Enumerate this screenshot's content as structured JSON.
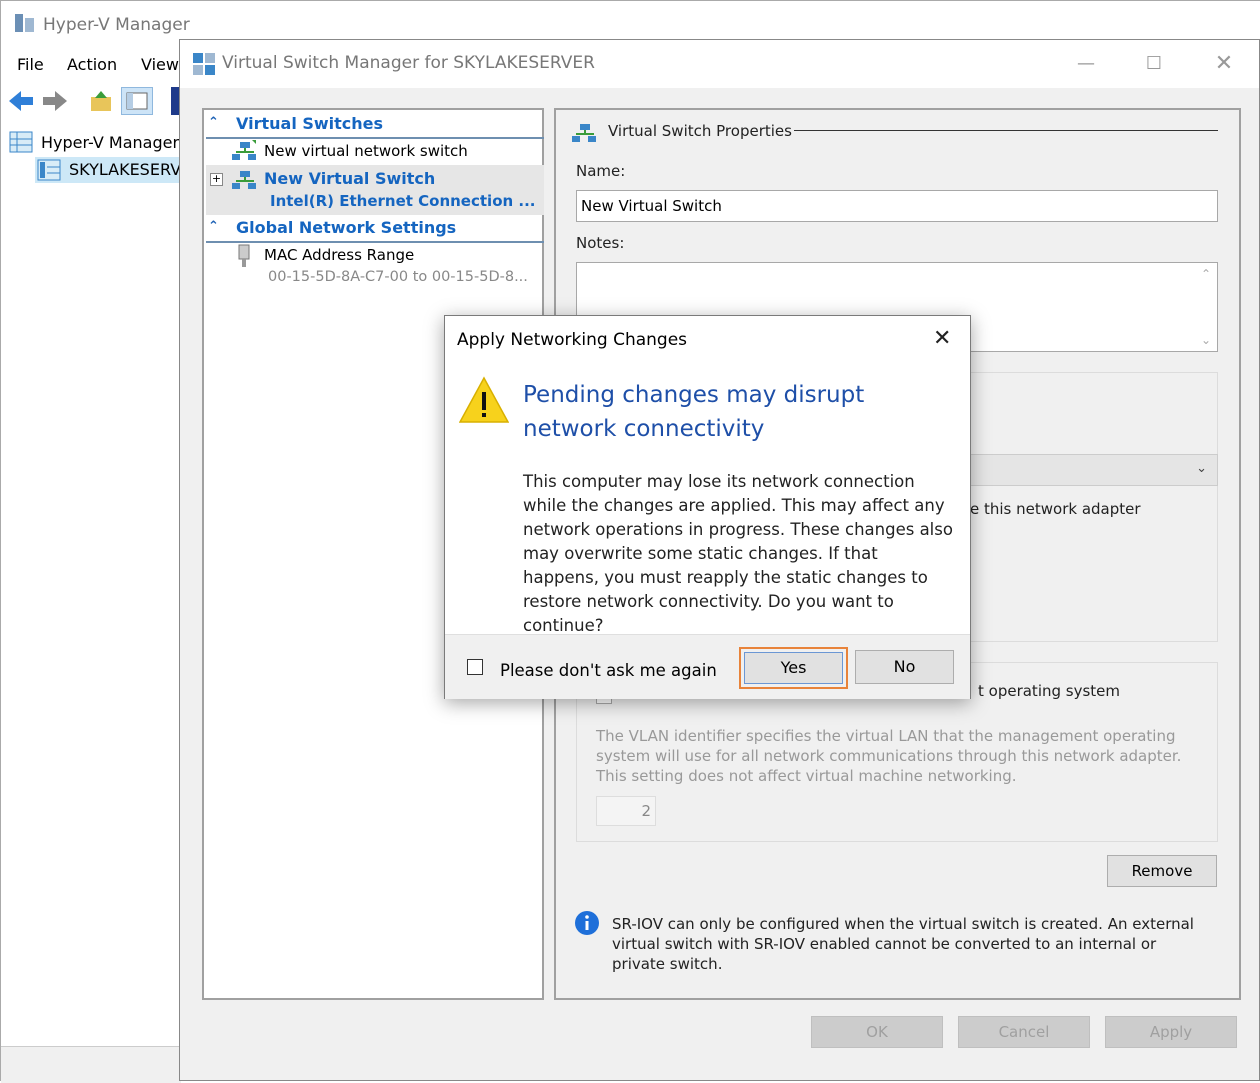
{
  "hyperv": {
    "title": "Hyper-V Manager",
    "menu": [
      "File",
      "Action",
      "View"
    ],
    "tree": {
      "root": "Hyper-V Manager",
      "server": "SKYLAKESERVE"
    }
  },
  "vsm": {
    "title": "Virtual Switch Manager for SKYLAKESERVER",
    "left": {
      "virtual_switches": "Virtual Switches",
      "new_switch_item": "New virtual network switch",
      "switch_name": "New Virtual Switch",
      "switch_adapter": "Intel(R) Ethernet Connection ...",
      "global_settings": "Global Network Settings",
      "mac_label": "MAC Address Range",
      "mac_value": "00-15-5D-8A-C7-00 to 00-15-5D-8..."
    },
    "right": {
      "properties_header": "Virtual Switch Properties",
      "name_label": "Name:",
      "name_value": "New Virtual Switch",
      "notes_label": "Notes:",
      "adapter_text": "e this network adapter",
      "os_text": "t operating system",
      "vlan_description": "The VLAN identifier specifies the virtual LAN that the management operating system will use for all network communications through this network adapter. This setting does not affect virtual machine networking.",
      "vlan_id": "2",
      "remove_label": "Remove",
      "sriov_info": "SR-IOV can only be configured when the virtual switch is created. An external virtual switch with SR-IOV enabled cannot be converted to an internal or private switch."
    },
    "buttons": {
      "ok": "OK",
      "cancel": "Cancel",
      "apply": "Apply"
    }
  },
  "dialog": {
    "title": "Apply Networking Changes",
    "heading": "Pending changes may disrupt network connectivity",
    "body": "This computer may lose its network connection while the changes are applied. This may affect any network operations in progress. These changes also may overwrite some static changes. If that happens, you must reapply the static changes to restore network connectivity. Do you want to continue?",
    "checkbox_label": "Please don't ask me again",
    "yes": "Yes",
    "no": "No"
  },
  "colors": {
    "accent": "#1565c0",
    "focus": "#e8833a",
    "heading": "#1e4fa8",
    "warning": "#f7d21c"
  }
}
